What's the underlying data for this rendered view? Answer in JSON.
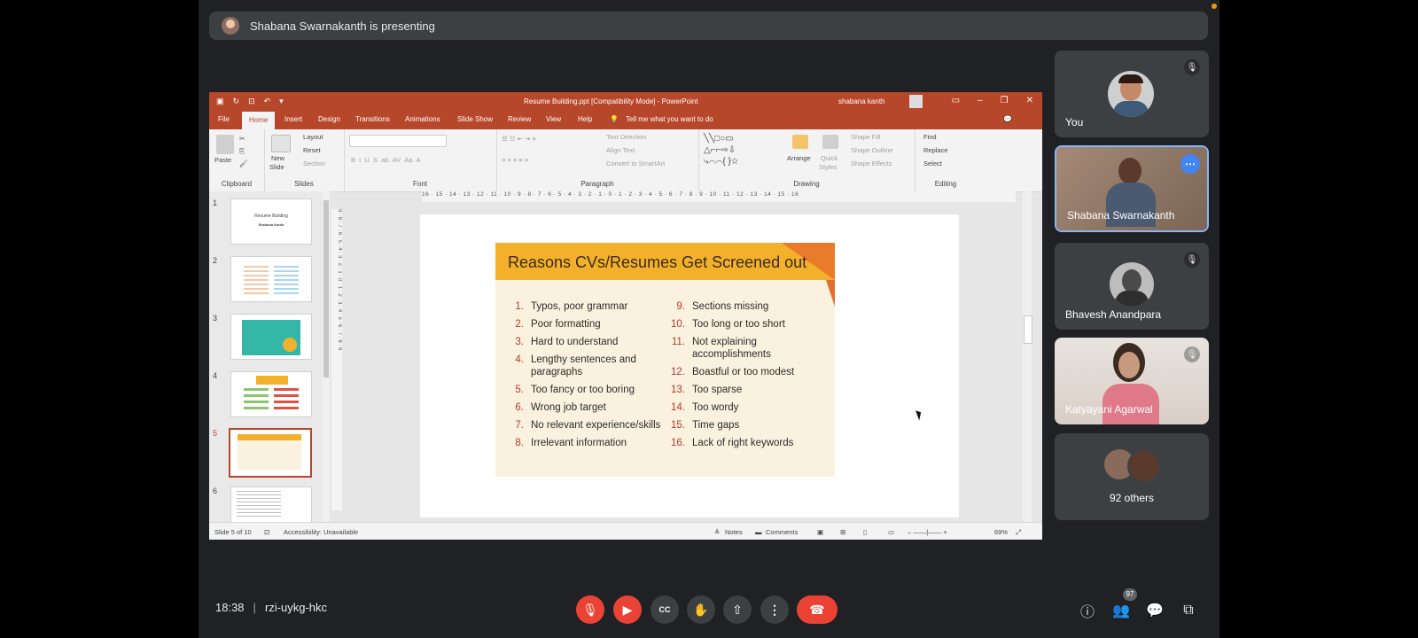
{
  "meet": {
    "presenting_text": "Shabana Swarnakanth is presenting",
    "time": "18:38",
    "separator": "|",
    "meeting_code": "rzi-uykg-hkc",
    "participants_badge": "97"
  },
  "ppt": {
    "window_title": "Resume Building.ppt [Compatibility Mode] - PowerPoint",
    "user_name": "shabana kanth",
    "tabs": [
      "File",
      "Home",
      "Insert",
      "Design",
      "Transitions",
      "Animations",
      "Slide Show",
      "Review",
      "View",
      "Help"
    ],
    "tell_me": "Tell me what you want to do",
    "ribbon": {
      "paste": "Paste",
      "new_slide": "New",
      "new_slide_2": "Slide",
      "layout": "Layout",
      "reset": "Reset",
      "section": "Section",
      "text_direction": "Text Direction",
      "align_text": "Align Text",
      "convert_smartart": "Convert to SmartArt",
      "arrange": "Arrange",
      "quick_styles": "Quick",
      "quick_styles_2": "Styles",
      "shape_fill": "Shape Fill",
      "shape_outline": "Shape Outline",
      "shape_effects": "Shape Effects",
      "find": "Find",
      "replace": "Replace",
      "select": "Select",
      "groups": [
        "Clipboard",
        "Slides",
        "Font",
        "Paragraph",
        "Drawing",
        "Editing"
      ]
    },
    "thumbnails": [
      {
        "num": "1",
        "title": "Resume Building",
        "sub": "Shabana Kanth"
      },
      {
        "num": "2"
      },
      {
        "num": "3"
      },
      {
        "num": "4"
      },
      {
        "num": "5"
      },
      {
        "num": "6"
      }
    ],
    "status": {
      "slide_of": "Slide 5 of 10",
      "accessibility": "Accessibility: Unavailable",
      "notes": "Notes",
      "comments": "Comments",
      "zoom": "69%"
    },
    "ruler_h": "16 · 15 · 14 · 13 · 12 · 11 · 10 · 9 · 8 · 7 · 6 · 5 · 4 · 3 · 2 · 1 · 0 · 1 · 2 · 3 · 4 · 5 · 6 · 7 · 8 · 9 · 10 · 11 · 12 · 13 · 14 · 15 · 16",
    "ruler_v": "9 · 8 · 7 · 6 · 5 · 4 · 3 · 2 · 1 · 0 · 1 · 2 · 3 · 4 · 5 · 6 · 7 · 8 · 9"
  },
  "slide": {
    "title": "Reasons CVs/Resumes Get Screened out",
    "left_items": [
      {
        "n": "1.",
        "text": "Typos, poor grammar"
      },
      {
        "n": "2.",
        "text": "Poor formatting"
      },
      {
        "n": "3.",
        "text": "Hard to understand"
      },
      {
        "n": "4.",
        "text": "Lengthy sentences and paragraphs"
      },
      {
        "n": "5.",
        "text": "Too fancy or too boring"
      },
      {
        "n": "6.",
        "text": "Wrong job target"
      },
      {
        "n": "7.",
        "text": "No relevant experience/skills"
      },
      {
        "n": "8.",
        "text": "Irrelevant information"
      }
    ],
    "right_items": [
      {
        "n": "9.",
        "text": "Sections missing"
      },
      {
        "n": "10.",
        "text": "Too long or too short"
      },
      {
        "n": "11.",
        "text": "Not explaining accomplishments"
      },
      {
        "n": "12.",
        "text": "Boastful or too modest"
      },
      {
        "n": "13.",
        "text": "Too sparse"
      },
      {
        "n": "14.",
        "text": "Too wordy"
      },
      {
        "n": "15.",
        "text": "Time gaps"
      },
      {
        "n": "16.",
        "text": "Lack of right keywords"
      }
    ]
  },
  "participants": [
    {
      "name": "You"
    },
    {
      "name": "Shabana Swarnakanth"
    },
    {
      "name": "Bhavesh Anandpara"
    },
    {
      "name": "Katyayani Agarwal"
    },
    {
      "name": "92 others"
    }
  ],
  "colors": {
    "ppt_accent": "#b7472a",
    "meet_bg": "#202124",
    "end_call": "#ea4335",
    "active_speaker": "#8ab4f8"
  },
  "icons": [
    "mic-off-icon",
    "camera-off-icon",
    "captions-icon",
    "raise-hand-icon",
    "present-icon",
    "more-options-icon",
    "end-call-icon",
    "info-icon",
    "people-icon",
    "chat-icon",
    "activities-icon"
  ]
}
